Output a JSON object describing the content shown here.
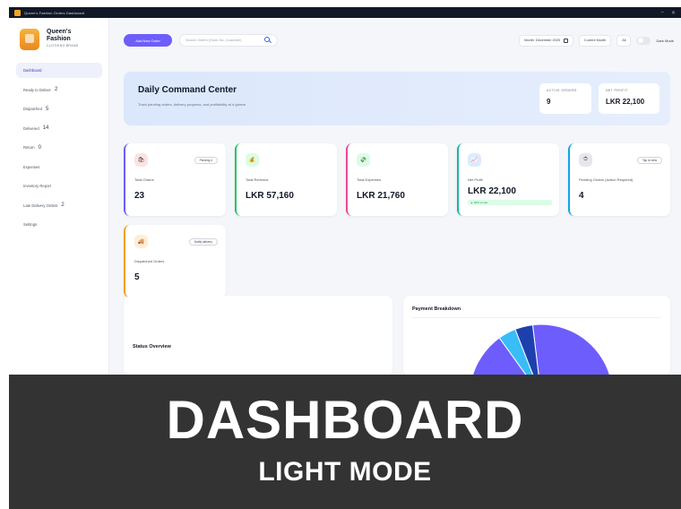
{
  "window": {
    "title": "Queen's Fashion Orders Dashboard"
  },
  "brand": {
    "name": "Queen's Fashion",
    "subtitle": "CLOTHING BRAND"
  },
  "sidebar": {
    "items": [
      {
        "label": "Dashboard",
        "count": ""
      },
      {
        "label": "Ready to Deliver",
        "count": "2"
      },
      {
        "label": "Dispatched",
        "count": "5"
      },
      {
        "label": "Delivered",
        "count": "14"
      },
      {
        "label": "Return",
        "count": "0"
      },
      {
        "label": "Expenses",
        "count": ""
      },
      {
        "label": "Inventory Report",
        "count": ""
      },
      {
        "label": "Late Delivery Orders",
        "count": "2"
      },
      {
        "label": "Settings",
        "count": ""
      }
    ]
  },
  "topbar": {
    "add_button": "Add New Order",
    "search_placeholder": "Search Orders (Order No, Customer)",
    "month_filter": "Month: December 2025",
    "period_filter": "Current Month",
    "scope_filter": "All",
    "dark_mode_label": "Dark Mode"
  },
  "hero": {
    "title": "Daily Command Center",
    "subtitle": "Track pending orders, delivery progress, and profitability at a glance",
    "active_orders_label": "ACTIVE ORDERS",
    "active_orders_value": "9",
    "net_profit_label": "NET PROFIT",
    "net_profit_value": "LKR 22,100"
  },
  "cards": [
    {
      "label": "Total Orders",
      "value": "23",
      "pill": "Pending 4",
      "icon": "cart-icon",
      "accent": "#6d5dfc",
      "icon_bg": "#fde2e2"
    },
    {
      "label": "Total Revenue",
      "value": "LKR 57,160",
      "pill": "",
      "icon": "money-icon",
      "accent": "#22c55e",
      "icon_bg": "#dcfce7"
    },
    {
      "label": "Total Expenses",
      "value": "LKR 21,760",
      "pill": "",
      "icon": "expense-icon",
      "accent": "#ec4899",
      "icon_bg": "#dcfce7"
    },
    {
      "label": "Net Profit",
      "value": "LKR 22,100",
      "pill": "",
      "icon": "chart-icon",
      "accent": "#14b8a6",
      "icon_bg": "#dbeafe",
      "trend": "▲ 38% vs last"
    },
    {
      "label": "Pending Orders (Action Required)",
      "value": "4",
      "pill": "Tap to view",
      "icon": "clock-icon",
      "accent": "#0ea5e9",
      "icon_bg": "#e5e7eb"
    },
    {
      "label": "Dispatched Orders",
      "value": "5",
      "pill": "Notify delivery",
      "icon": "truck-icon",
      "accent": "#f59e0b",
      "icon_bg": "#ffedd5"
    }
  ],
  "panels": {
    "status_title": "Status Overview",
    "payment_title": "Payment Breakdown"
  },
  "pie": {
    "slices": [
      {
        "color": "#6d5dfc",
        "value": 0.92
      },
      {
        "color": "#38bdf8",
        "value": 0.04
      },
      {
        "color": "#1e40af",
        "value": 0.04
      }
    ]
  },
  "banner": {
    "title": "DASHBOARD",
    "subtitle": "LIGHT MODE"
  }
}
